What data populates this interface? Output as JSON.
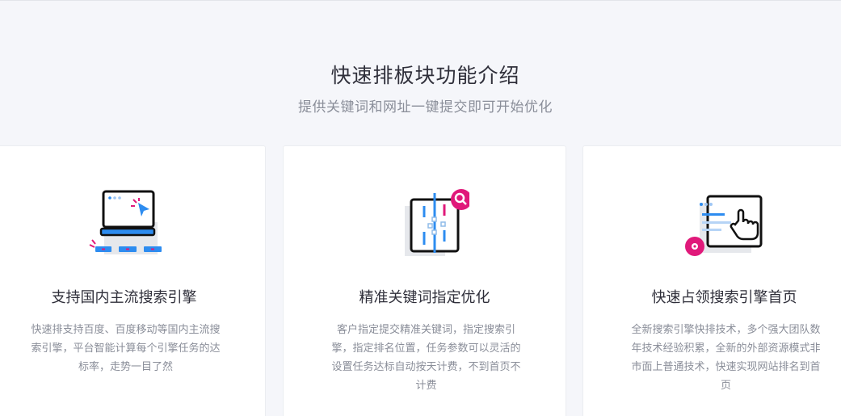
{
  "section": {
    "title": "快速排板块功能介绍",
    "subtitle": "提供关键词和网址一键提交即可开始优化"
  },
  "cards": [
    {
      "icon": "laptop-cursor-icon",
      "title": "支持国内主流搜索引擎",
      "description": "快速排支持百度、百度移动等国内主流搜索引擎，平台智能计算每个引擎任务的达标率，走势一目了然"
    },
    {
      "icon": "keyword-search-icon",
      "title": "精准关键词指定优化",
      "description": "客户指定提交精准关键词，指定搜索引擎，指定排名位置，任务参数可以灵活的设置任务达标自动按天计费，不到首页不计费"
    },
    {
      "icon": "browser-hand-icon",
      "title": "快速占领搜索引擎首页",
      "description": "全新搜索引擎快排技术，多个强大团队数年技术经验积累，全新的外部资源模式非市面上普通技术，快速实现网站排名到首页"
    }
  ],
  "colors": {
    "accent_blue": "#2d8cf0",
    "accent_magenta": "#e0197a",
    "outline": "#111111"
  }
}
